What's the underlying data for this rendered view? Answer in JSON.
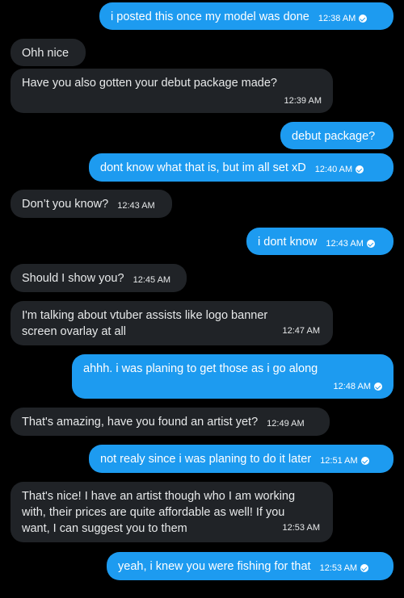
{
  "messages": [
    {
      "type": "sent",
      "text": "i posted this once my model was done",
      "time": "12:38 AM",
      "read": true
    },
    {
      "type": "recv",
      "text": "Ohh nice",
      "time": ""
    },
    {
      "type": "recv",
      "text": "Have you also gotten your debut package made?",
      "time": "12:39 AM"
    },
    {
      "type": "sent",
      "text": "debut package?",
      "time": ""
    },
    {
      "type": "sent",
      "text": "dont know what that is, but im all set xD",
      "time": "12:40 AM",
      "read": true
    },
    {
      "type": "recv",
      "text": "Don’t you know?",
      "time": "12:43 AM"
    },
    {
      "type": "sent",
      "text": "i dont know",
      "time": "12:43 AM",
      "read": true
    },
    {
      "type": "recv",
      "text": "Should I show you?",
      "time": "12:45 AM"
    },
    {
      "type": "recv",
      "text": "I'm talking about vtuber assists like logo banner screen ovarlay at all",
      "time": "12:47 AM"
    },
    {
      "type": "sent",
      "text": "ahhh. i was planing to get those as i go along",
      "time": "12:48 AM",
      "read": true
    },
    {
      "type": "recv",
      "text": "That's amazing, have you found an artist yet?",
      "time": "12:49 AM"
    },
    {
      "type": "sent",
      "text": "not realy since i was planing to do it later",
      "time": "12:51 AM",
      "read": true
    },
    {
      "type": "recv",
      "text": "That's nice! I have an artist though who I am working with, their prices are quite affordable as well! If you want, I can suggest you to them",
      "time": "12:53 AM"
    },
    {
      "type": "sent",
      "text": "yeah, i knew you were fishing for that",
      "time": "12:53 AM",
      "read": true
    }
  ],
  "colors": {
    "sent_bubble": "#1d9bf0",
    "received_bubble": "#202327",
    "background": "#000000"
  },
  "icons": {
    "read_receipt": "check-circle-icon"
  }
}
